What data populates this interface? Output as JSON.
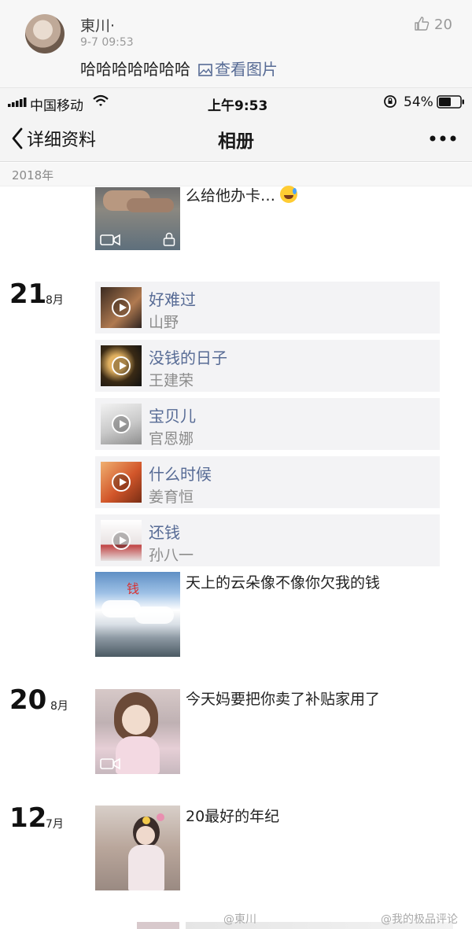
{
  "comment": {
    "name": "東川·",
    "time": "9-7 09:53",
    "text": "哈哈哈哈哈哈哈",
    "link": "查看图片",
    "like_count": "20",
    "icons": [
      "avatar",
      "image-icon",
      "thumbs-up-icon"
    ]
  },
  "status_bar": {
    "carrier": "中国移动",
    "time": "上午9:53",
    "battery": "54%"
  },
  "nav": {
    "back_label": "详细资料",
    "title": "相册"
  },
  "year_label": "2018年",
  "posts": {
    "top_partial": {
      "text": "么给他办卡…"
    },
    "aug21": {
      "day": "21",
      "month": "8月",
      "music": [
        {
          "title": "好难过",
          "artist": "山野"
        },
        {
          "title": "没钱的日子",
          "artist": "王建荣"
        },
        {
          "title": "宝贝儿",
          "artist": "官恩娜"
        },
        {
          "title": "什么时候",
          "artist": "姜育恒"
        },
        {
          "title": "还钱",
          "artist": "孙八一"
        }
      ],
      "photo_text": "天上的云朵像不像你欠我的钱",
      "photo_caption": "钱"
    },
    "aug20": {
      "day": "20",
      "month": "8月",
      "text": "今天妈要把你卖了补贴家用了"
    },
    "jul12": {
      "day": "12",
      "month": "7月",
      "text": "20最好的年纪"
    }
  },
  "watermarks": [
    "@東川",
    "@我的极品评论"
  ],
  "colors": {
    "link": "#576b95",
    "music_bg": "#f3f3f5"
  }
}
